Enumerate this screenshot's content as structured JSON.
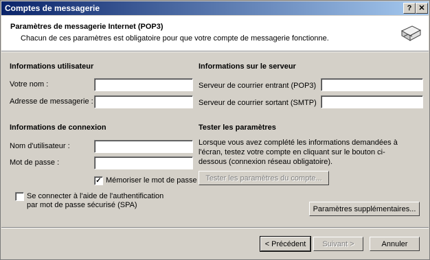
{
  "window": {
    "title": "Comptes de messagerie",
    "help_btn": "?",
    "close_btn": "✕"
  },
  "header": {
    "title": "Paramètres de messagerie Internet (POP3)",
    "subtitle": "Chacun de ces paramètres est obligatoire pour que votre compte de messagerie fonctionne.",
    "icon": "mail-account-icon"
  },
  "user_info": {
    "heading": "Informations utilisateur",
    "name_label": "Votre nom :",
    "name_value": "",
    "email_label": "Adresse de messagerie :",
    "email_value": ""
  },
  "server_info": {
    "heading": "Informations sur le serveur",
    "incoming_label": "Serveur de courrier entrant (POP3)",
    "incoming_value": "",
    "outgoing_label": "Serveur de courrier sortant (SMTP)",
    "outgoing_value": ""
  },
  "login_info": {
    "heading": "Informations de connexion",
    "username_label": "Nom d'utilisateur :",
    "username_value": "",
    "password_label": "Mot de passe :",
    "password_value": "",
    "remember_label": "Mémoriser le mot de passe",
    "remember_checked": true,
    "spa_label_line1": "Se connecter à l'aide de l'authentification",
    "spa_label_line2": "par mot de passe sécurisé (SPA)",
    "spa_checked": false
  },
  "test": {
    "heading": "Tester les paramètres",
    "description": "Lorsque vous avez complété les informations demandées à l'écran, testez votre compte en cliquant sur le bouton ci-dessous (connexion réseau obligatoire).",
    "test_button": "Tester les paramètres du compte...",
    "more_settings_button": "Paramètres supplémentaires..."
  },
  "footer": {
    "back_button": "< Précédent",
    "next_button": "Suivant >",
    "cancel_button": "Annuler"
  }
}
